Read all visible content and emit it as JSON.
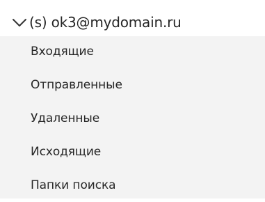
{
  "account": {
    "label": "(s) ok3@mydomain.ru",
    "expand_icon": "chevron-down-icon"
  },
  "folders": [
    {
      "label": "Входящие"
    },
    {
      "label": "Отправленные"
    },
    {
      "label": "Удаленные"
    },
    {
      "label": "Исходящие"
    },
    {
      "label": "Папки поиска"
    }
  ],
  "colors": {
    "background": "#ffffff",
    "folder_list_background": "#f3f3f3",
    "text": "#262626"
  }
}
